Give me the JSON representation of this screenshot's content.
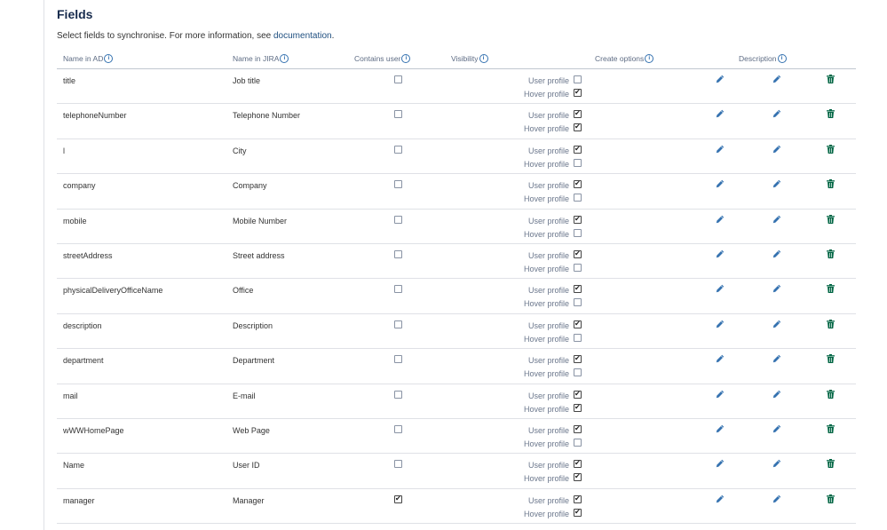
{
  "section": {
    "title": "Fields",
    "intro_text": "Select fields to synchronise. For more information, see ",
    "intro_link": "documentation",
    "intro_end": "."
  },
  "columns": {
    "name_ad": "Name in AD",
    "name_jira": "Name in JIRA",
    "contains_user": "Contains user",
    "visibility": "Visibility",
    "create_options": "Create options",
    "description": "Description"
  },
  "labels": {
    "user_profile": "User profile",
    "hover_profile": "Hover profile"
  },
  "icons": {
    "edit": "pencil-icon",
    "delete": "trash-icon",
    "info": "info-icon",
    "edit_color": "#3572b0",
    "delete_color": "#006644"
  },
  "rows": [
    {
      "ad": "title",
      "jira": "Job title",
      "contains_user": false,
      "user_profile": false,
      "hover_profile": true
    },
    {
      "ad": "telephoneNumber",
      "jira": "Telephone Number",
      "contains_user": false,
      "user_profile": true,
      "hover_profile": true
    },
    {
      "ad": "l",
      "jira": "City",
      "contains_user": false,
      "user_profile": true,
      "hover_profile": false
    },
    {
      "ad": "company",
      "jira": "Company",
      "contains_user": false,
      "user_profile": true,
      "hover_profile": false
    },
    {
      "ad": "mobile",
      "jira": "Mobile Number",
      "contains_user": false,
      "user_profile": true,
      "hover_profile": false
    },
    {
      "ad": "streetAddress",
      "jira": "Street address",
      "contains_user": false,
      "user_profile": true,
      "hover_profile": false
    },
    {
      "ad": "physicalDeliveryOfficeName",
      "jira": "Office",
      "contains_user": false,
      "user_profile": true,
      "hover_profile": false
    },
    {
      "ad": "description",
      "jira": "Description",
      "contains_user": false,
      "user_profile": true,
      "hover_profile": false
    },
    {
      "ad": "department",
      "jira": "Department",
      "contains_user": false,
      "user_profile": true,
      "hover_profile": false
    },
    {
      "ad": "mail",
      "jira": "E-mail",
      "contains_user": false,
      "user_profile": true,
      "hover_profile": true
    },
    {
      "ad": "wWWHomePage",
      "jira": "Web Page",
      "contains_user": false,
      "user_profile": true,
      "hover_profile": false
    },
    {
      "ad": "Name",
      "jira": "User ID",
      "contains_user": false,
      "user_profile": true,
      "hover_profile": true
    },
    {
      "ad": "manager",
      "jira": "Manager",
      "contains_user": true,
      "user_profile": true,
      "hover_profile": true
    }
  ]
}
